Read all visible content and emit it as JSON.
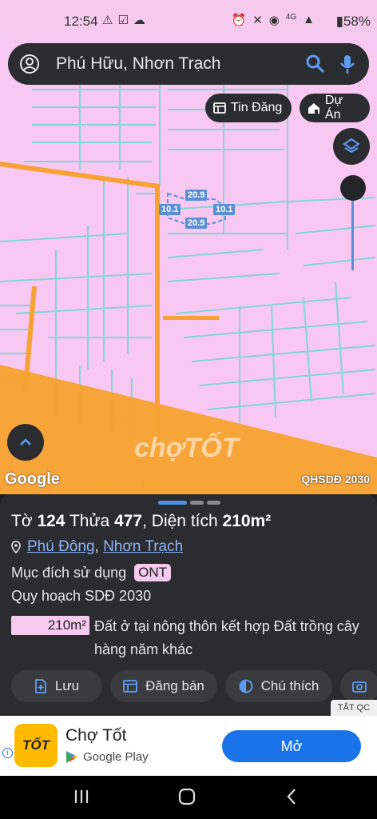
{
  "status_bar": {
    "time": "12:54",
    "left_icons": [
      "warning-icon",
      "check-icon",
      "cloud-icon"
    ],
    "right_icons": [
      "alarm-icon",
      "vibrate-icon",
      "location-icon",
      "signal-4g-icon",
      "cell-signal-icon"
    ],
    "battery": "58%"
  },
  "search": {
    "query": "Phú Hữu, Nhơn Trạch"
  },
  "chips": {
    "tin_dang": "Tin Đăng",
    "du_an": "Dự Án"
  },
  "map": {
    "dims": {
      "top": "20.9",
      "bottom": "20.9",
      "left": "10.1",
      "right": "10.1"
    },
    "google_logo": "Google",
    "attribution": "QHSDĐ 2030",
    "watermark": "chợTỐT",
    "colors": {
      "land": "#f8c8f2",
      "road": "#f7a232",
      "parcel_line": "#7fd8d8"
    }
  },
  "sheet": {
    "title_prefix": "Tờ",
    "sheet_no": "124",
    "parcel_label": "Thửa",
    "parcel_no": "477",
    "area_label": "Diện tích",
    "area_value": "210m²",
    "location_1": "Phú Đông",
    "location_sep": ",",
    "location_2": "Nhơn Trạch",
    "purpose_label": "Mục đích sử dụng",
    "purpose_code": "ONT",
    "plan_label": "Quy hoạch SDĐ 2030",
    "plan_area": "210m²",
    "plan_desc": "Đất ở tại nông thôn kết hợp Đất trồng cây hàng năm khác",
    "actions": {
      "save": "Lưu",
      "post": "Đăng bán",
      "legend": "Chú thích"
    }
  },
  "ad": {
    "close_label": "TẮT QC",
    "logo_text": "TỐT",
    "app_name": "Chợ Tốt",
    "store": "Google Play",
    "open": "Mở"
  }
}
